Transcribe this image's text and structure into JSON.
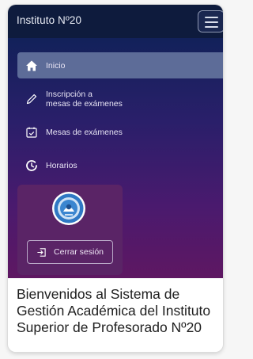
{
  "navbar": {
    "brand": "Instituto Nº20",
    "toggle_icon": "hamburger-icon"
  },
  "sidebar": {
    "items": [
      {
        "label": "Inicio",
        "icon": "home-icon",
        "active": true
      },
      {
        "label_line1": "Inscripción a",
        "label_line2": "mesas de exámenes",
        "icon": "pencil-icon"
      },
      {
        "label": "Mesas de exámenes",
        "icon": "calendar-check-icon"
      },
      {
        "label": "Horarios",
        "icon": "clock-icon"
      }
    ],
    "user_card": {
      "logo": "institute-logo",
      "logout_label": "Cerrar sesión",
      "logout_icon": "logout-icon"
    }
  },
  "main": {
    "welcome_title": "Bienvenidos al Sistema de Gestión Académica del Instituto Superior de Profesorado Nº20"
  },
  "colors": {
    "navbar_bg": "#0e1b3d",
    "sidebar_gradient_top": "#12215a",
    "sidebar_gradient_bottom": "#5e1762",
    "active_item_bg": "#5d6c98",
    "user_card_bg": "#5a2466"
  }
}
